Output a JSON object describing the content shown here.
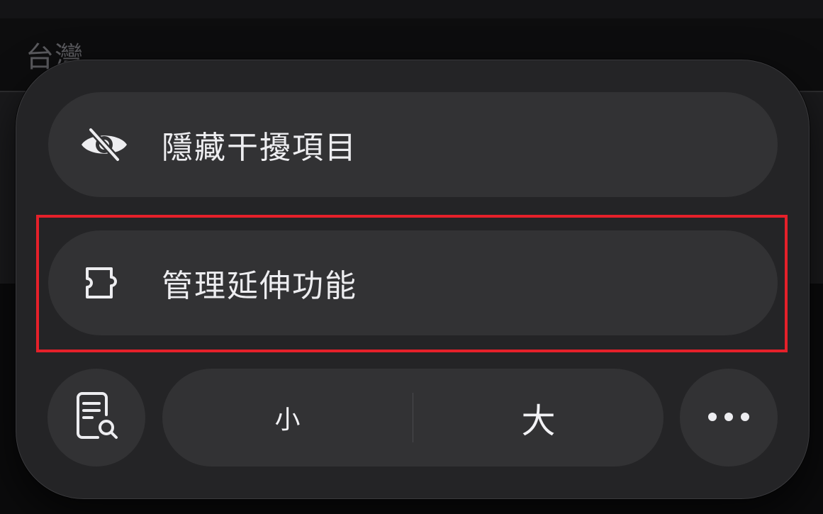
{
  "background": {
    "title": "台灣"
  },
  "menu": {
    "items": [
      {
        "label": "隱藏干擾項目",
        "icon": "eye-slash-icon"
      },
      {
        "label": "管理延伸功能",
        "icon": "puzzle-piece-icon"
      }
    ],
    "font_size": {
      "smaller_label": "小",
      "larger_label": "大"
    },
    "reader_icon": "page-search-icon",
    "more_icon": "ellipsis-icon"
  },
  "colors": {
    "highlight": "#e5202a",
    "panel": "#242426",
    "row": "#323234"
  }
}
